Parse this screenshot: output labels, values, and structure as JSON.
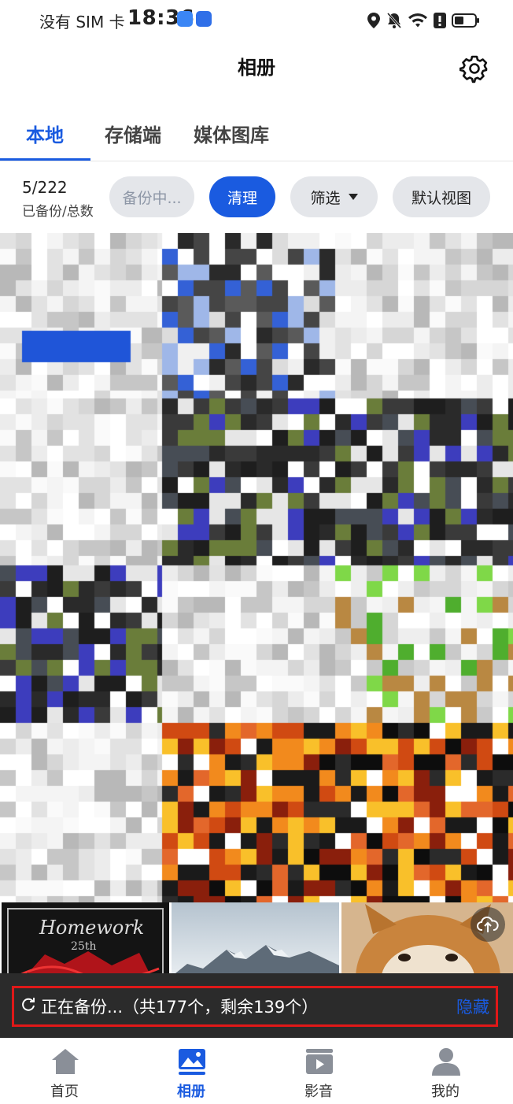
{
  "status_bar": {
    "carrier": "没有 SIM 卡",
    "time": "18:36"
  },
  "header": {
    "title": "相册"
  },
  "tabs": [
    {
      "label": "本地",
      "active": true
    },
    {
      "label": "存储端",
      "active": false
    },
    {
      "label": "媒体图库",
      "active": false
    }
  ],
  "stats": {
    "count": "5/222",
    "count_label": "已备份/总数"
  },
  "actions": {
    "backing": "备份中...",
    "clean": "清理",
    "filter": "筛选",
    "view": "默认视图"
  },
  "banner": {
    "text": "正在备份...（共177个，剩余139个）",
    "hide": "隐藏"
  },
  "nav": [
    {
      "label": "首页",
      "icon": "home-icon",
      "active": false
    },
    {
      "label": "相册",
      "icon": "photo-icon",
      "active": true
    },
    {
      "label": "影音",
      "icon": "video-icon",
      "active": false
    },
    {
      "label": "我的",
      "icon": "person-icon",
      "active": false
    }
  ],
  "colors": {
    "accent": "#1a5be0",
    "highlight_border": "#e01818",
    "banner_bg": "#2b2b2b"
  }
}
